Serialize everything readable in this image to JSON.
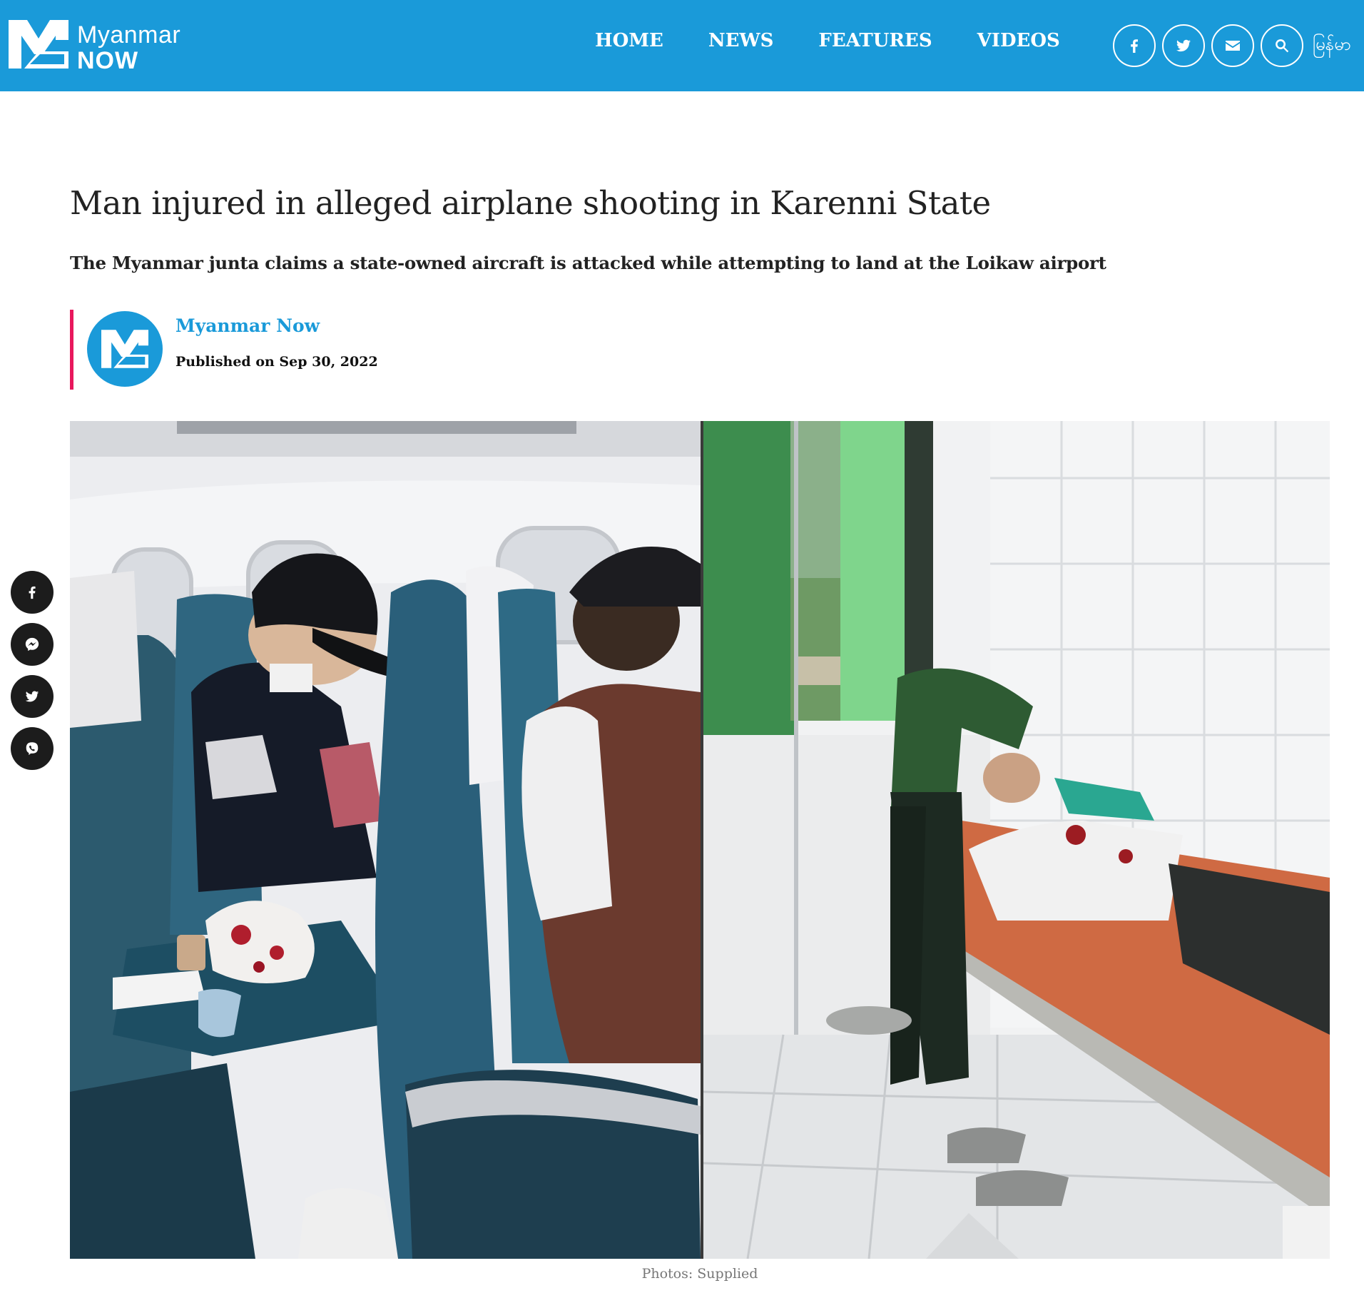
{
  "site": {
    "logo_line1": "Myanmar",
    "logo_line2": "NOW",
    "brand_color": "#1a9ad9",
    "accent_color": "#e8175d"
  },
  "nav": {
    "items": [
      {
        "label": "HOME"
      },
      {
        "label": "NEWS"
      },
      {
        "label": "FEATURES"
      },
      {
        "label": "VIDEOS"
      }
    ]
  },
  "header_icons": [
    "facebook-icon",
    "twitter-icon",
    "email-icon",
    "search-icon"
  ],
  "language_switch": "မြန်မာ",
  "article": {
    "title": "Man injured in alleged airplane shooting in Karenni State",
    "subtitle": "The Myanmar junta claims a state-owned aircraft is attacked while attempting to land at the Loikaw airport",
    "author": "Myanmar Now",
    "published": "Published on Sep 30, 2022",
    "photo_caption": "Photos: Supplied"
  },
  "share_sidebar": [
    "facebook-icon",
    "messenger-icon",
    "twitter-icon",
    "viber-icon"
  ]
}
